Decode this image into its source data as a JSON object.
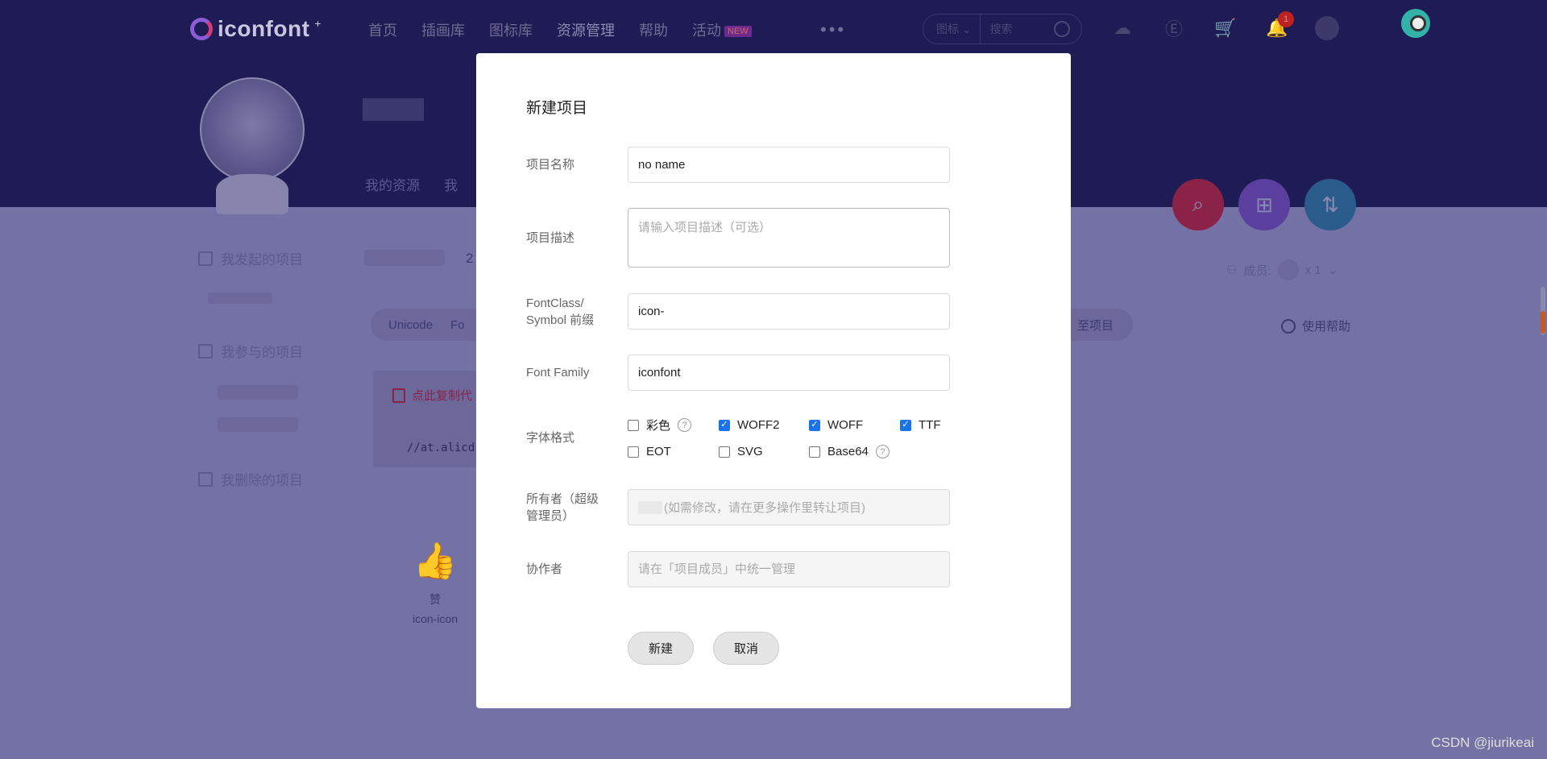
{
  "nav": {
    "logo_text": "iconfont",
    "logo_plus": "+",
    "links": [
      "首页",
      "插画库",
      "图标库",
      "资源管理",
      "帮助",
      "活动"
    ],
    "new_badge": "NEW",
    "more": "•••",
    "search_category": "图标",
    "search_placeholder": "搜索",
    "notification_count": "1"
  },
  "profile": {
    "tabs": [
      "我的资源",
      "我"
    ]
  },
  "sidebar": {
    "items": [
      "我发起的项目",
      "我参与的项目",
      "我删除的项目"
    ]
  },
  "project": {
    "count_digit": "2",
    "members_label": "成员:",
    "members_count": "x 1",
    "tabs": [
      "Unicode",
      "Fo"
    ],
    "tab_right": "至项目",
    "help": "使用帮助",
    "copy_tip": "点此复制代",
    "code": "//at.alicd",
    "icon_name": "赞",
    "icon_class": "icon-icon"
  },
  "modal": {
    "title": "新建项目",
    "name_label": "项目名称",
    "name_value": "no name",
    "desc_label": "项目描述",
    "desc_placeholder": "请输入项目描述（可选）",
    "prefix_label_1": "FontClass/",
    "prefix_label_2": "Symbol 前缀",
    "prefix_value": "icon-",
    "family_label": "Font Family",
    "family_value": "iconfont",
    "format_label": "字体格式",
    "formats": [
      {
        "label": "彩色",
        "checked": false,
        "help": true
      },
      {
        "label": "WOFF2",
        "checked": true,
        "help": false
      },
      {
        "label": "WOFF",
        "checked": true,
        "help": false
      },
      {
        "label": "TTF",
        "checked": true,
        "help": false
      },
      {
        "label": "EOT",
        "checked": false,
        "help": false
      },
      {
        "label": "SVG",
        "checked": false,
        "help": false
      },
      {
        "label": "Base64",
        "checked": false,
        "help": true
      }
    ],
    "help_glyph": "?",
    "owner_label_1": "所有者（超级",
    "owner_label_2": "管理员）",
    "owner_hint": "(如需修改，请在更多操作里转让项目)",
    "collab_label": "协作者",
    "collab_placeholder": "请在「项目成员」中统一管理",
    "create_button": "新建",
    "cancel_button": "取消"
  },
  "watermark": "CSDN @jiurikeai",
  "colors": {
    "header_bg": "#1f1b55",
    "overlay_bg": "#7471a4",
    "checkbox_on": "#1a73e8"
  }
}
